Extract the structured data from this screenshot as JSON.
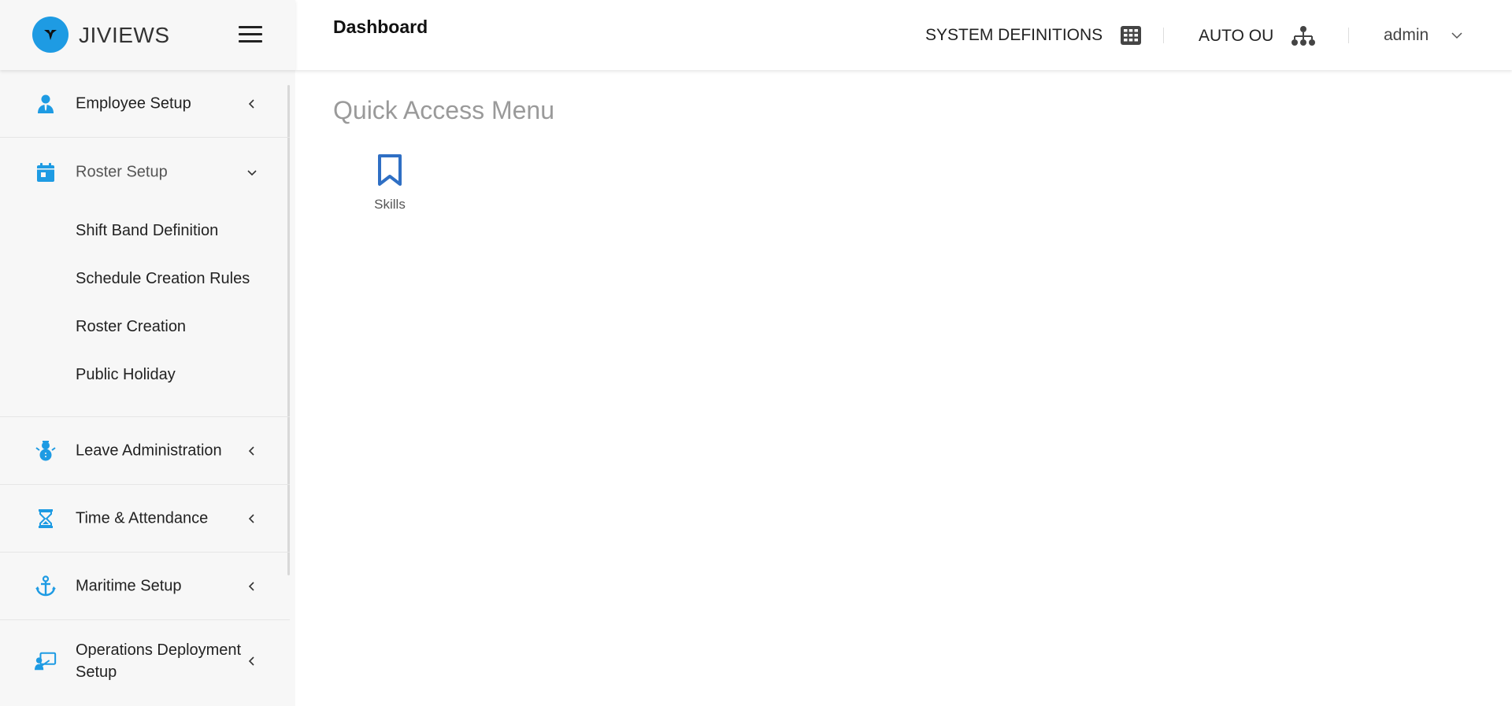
{
  "brand": {
    "name": "JIVIEWS",
    "logo_icon": "jiviews-logo-icon",
    "logo_color": "#1e9be3"
  },
  "sidebar": {
    "items": [
      {
        "label": "Employee Setup",
        "icon": "employee-icon"
      },
      {
        "label": "Roster Setup",
        "icon": "calendar-icon",
        "expanded": true,
        "children": [
          "Shift Band Definition",
          "Schedule Creation Rules",
          "Roster Creation",
          "Public Holiday"
        ]
      },
      {
        "label": "Leave Administration",
        "icon": "snowman-icon"
      },
      {
        "label": "Time & Attendance",
        "icon": "hourglass-icon"
      },
      {
        "label": "Maritime Setup",
        "icon": "anchor-icon"
      },
      {
        "label": "Operations Deployment Setup",
        "icon": "presentation-icon"
      }
    ],
    "accent_color": "#1e9be3"
  },
  "header": {
    "page_title": "Dashboard",
    "system_definitions": "SYSTEM DEFINITIONS",
    "auto_ou": "AUTO OU",
    "user": "admin"
  },
  "main": {
    "quick_access_title": "Quick Access Menu",
    "tiles": [
      {
        "label": "Skills",
        "icon": "bookmark-icon",
        "color": "#2f6fc4"
      }
    ]
  }
}
